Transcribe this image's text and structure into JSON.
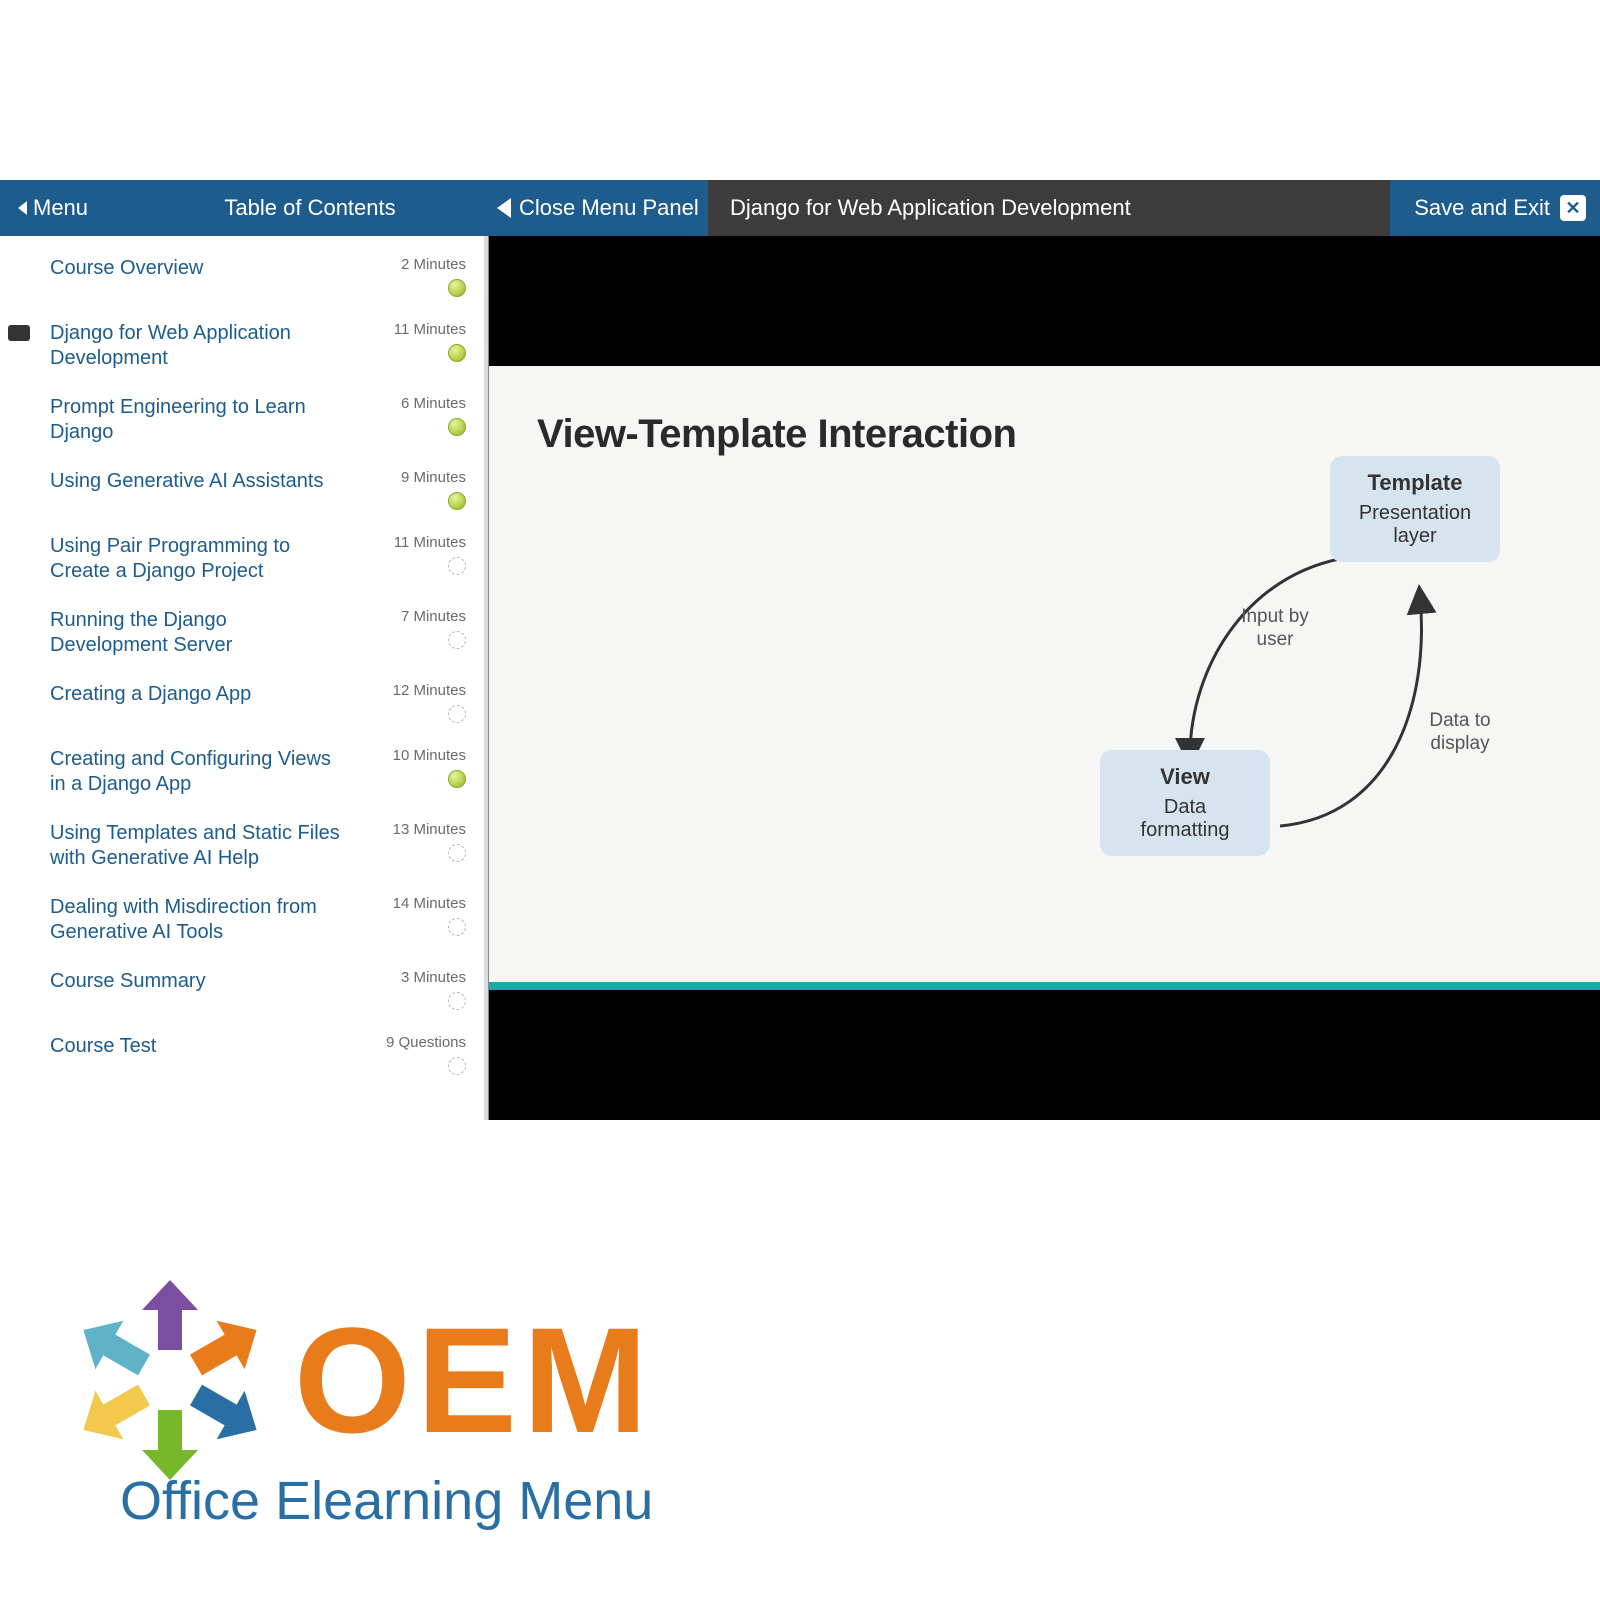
{
  "header": {
    "menu_label": "Menu",
    "toc_title": "Table of Contents",
    "close_panel_label": "Close Menu Panel",
    "course_title": "Django for Web Application Development",
    "save_exit_label": "Save and Exit"
  },
  "sidebar": {
    "items": [
      {
        "title": "Course Overview",
        "duration": "2 Minutes",
        "status": "complete",
        "current": false
      },
      {
        "title": "Django for Web Application Development",
        "duration": "11 Minutes",
        "status": "complete",
        "current": true
      },
      {
        "title": "Prompt Engineering to Learn Django",
        "duration": "6 Minutes",
        "status": "complete",
        "current": false
      },
      {
        "title": "Using Generative AI Assistants",
        "duration": "9 Minutes",
        "status": "complete",
        "current": false
      },
      {
        "title": "Using Pair Programming to Create a Django Project",
        "duration": "11 Minutes",
        "status": "empty",
        "current": false
      },
      {
        "title": "Running the Django Development Server",
        "duration": "7 Minutes",
        "status": "empty",
        "current": false
      },
      {
        "title": "Creating a Django App",
        "duration": "12 Minutes",
        "status": "empty",
        "current": false
      },
      {
        "title": "Creating and Configuring Views in a Django App",
        "duration": "10 Minutes",
        "status": "complete",
        "current": false
      },
      {
        "title": "Using Templates and Static Files with Generative AI Help",
        "duration": "13 Minutes",
        "status": "empty",
        "current": false
      },
      {
        "title": "Dealing with Misdirection from Generative AI Tools",
        "duration": "14 Minutes",
        "status": "empty",
        "current": false
      },
      {
        "title": "Course Summary",
        "duration": "3 Minutes",
        "status": "empty",
        "current": false
      },
      {
        "title": "Course Test",
        "duration": "9 Questions",
        "status": "empty",
        "current": false
      }
    ]
  },
  "slide": {
    "heading": "View-Template Interaction",
    "node_template_title": "Template",
    "node_template_sub": "Presentation layer",
    "node_view_title": "View",
    "node_view_sub": "Data formatting",
    "edge_input_label": "Input by user",
    "edge_output_label": "Data to display"
  },
  "logo": {
    "oem": "OEM",
    "tagline": "Office Elearning Menu",
    "arrow_colors": [
      "#7a4ea0",
      "#e87b1a",
      "#2a6fa3",
      "#76b82a",
      "#f2c94c",
      "#5fb3c9"
    ]
  }
}
